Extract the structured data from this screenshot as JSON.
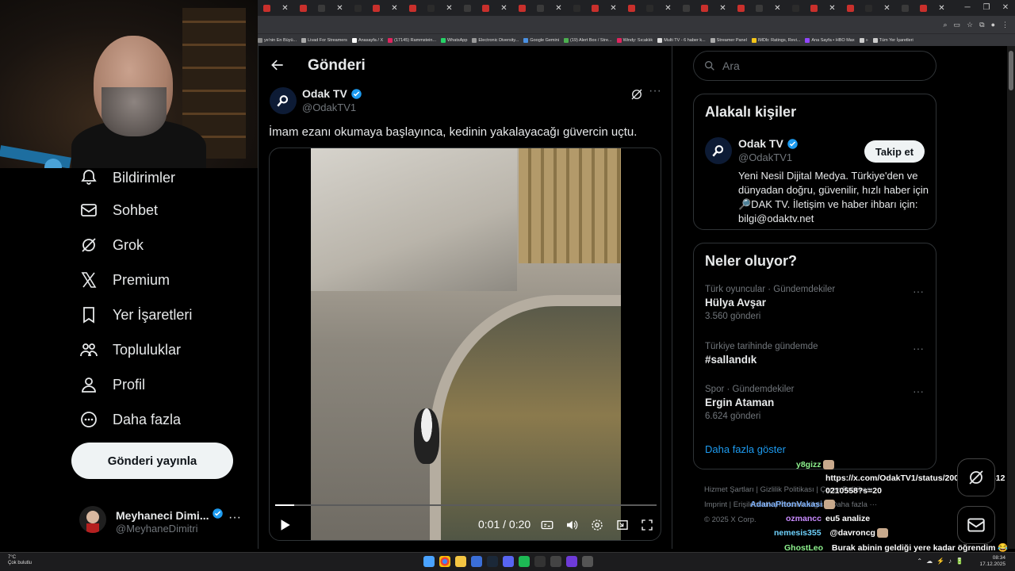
{
  "browser": {
    "tab_count": 38,
    "bookmarks": [
      "ye'nin En Büyü...",
      "Livad For Streamers",
      "Anasayfa / X",
      "(17145) Rammstein...",
      "WhatsApp",
      "Electronic Diversity...",
      "Google Gemini",
      "(19) Alert Box / Stre...",
      "Windy: Sıcaklık",
      "Multi TV - 6 haber k...",
      "Streamer Panel",
      "IMDb: Ratings, Revi...",
      "Ana Sayfa • HBO Max",
      "»",
      "Tüm Yer İşaretleri"
    ]
  },
  "nav": {
    "items": [
      {
        "label": "Bildirimler",
        "icon": "bell-icon"
      },
      {
        "label": "Sohbet",
        "icon": "mail-icon"
      },
      {
        "label": "Grok",
        "icon": "grok-icon"
      },
      {
        "label": "Premium",
        "icon": "x-logo-icon"
      },
      {
        "label": "Yer İşaretleri",
        "icon": "bookmark-icon"
      },
      {
        "label": "Topluluklar",
        "icon": "people-icon"
      },
      {
        "label": "Profil",
        "icon": "person-icon"
      },
      {
        "label": "Daha fazla",
        "icon": "more-circle-icon"
      }
    ],
    "post_button": "Gönderi yayınla",
    "account": {
      "name": "Meyhaneci Dimi...",
      "handle": "@MeyhaneDimitri",
      "more": "···"
    }
  },
  "main": {
    "header_title": "Gönderi",
    "tweet": {
      "author_name": "Odak TV",
      "author_handle": "@OdakTV1",
      "more": "···",
      "text": "İmam ezanı okumaya başlayınca, kedinin yakalayacağı güvercin uçtu.",
      "video": {
        "time": "0:01 / 0:20",
        "progress": 0.05
      }
    }
  },
  "right": {
    "search_placeholder": "Ara",
    "related": {
      "title": "Alakalı kişiler",
      "name": "Odak TV",
      "handle": "@OdakTV1",
      "follow_label": "Takip et",
      "bio": "Yeni Nesil Dijital Medya. Türkiye'den ve dünyadan doğru, güvenilir, hızlı haber için 🔎DAK TV. İletişim ve haber ihbarı için: bilgi@odaktv.net"
    },
    "trends": {
      "title": "Neler oluyor?",
      "items": [
        {
          "context": "Türk oyuncular · Gündemdekiler",
          "topic": "Hülya Avşar",
          "count": "3.560 gönderi"
        },
        {
          "context": "Türkiye tarihinde gündemde",
          "topic": "#sallandık",
          "count": ""
        },
        {
          "context": "Spor · Gündemdekiler",
          "topic": "Ergin Ataman",
          "count": "6.624 gönderi"
        }
      ],
      "show_more": "Daha fazla göster"
    },
    "footer": {
      "line1": "Hizmet Şartları  |  Gizlilik Politikası  |  Çerez Politikası",
      "line2": "Imprint  |  Erişilebilirlik  |  Reklam bilgisi  |  Daha fazla ···",
      "line3": "© 2025 X Corp."
    }
  },
  "chat": [
    {
      "user": "y8gizz",
      "message": "",
      "color": "#8ef28e"
    },
    {
      "user": "",
      "message": "https://x.com/OdakTV1/status/2000822292612",
      "color": "#ffffff"
    },
    {
      "user": "",
      "message": "0210558?s=20",
      "color": "#ffffff"
    },
    {
      "user": "AdanaPitonVakasi",
      "message": "",
      "color": "#7fb3ff"
    },
    {
      "user": "",
      "message": "eu5 analize",
      "color": "#ffffff"
    },
    {
      "user": "ozmancc",
      "message": "",
      "color": "#c98bff"
    },
    {
      "user": "nemesis355",
      "message": "@davroncg",
      "color": "#6fd3ff"
    },
    {
      "user": "GhostLeo",
      "message": "Burak abinin geldiği yere kadar öğrendim 😂",
      "color": "#8ef28e"
    },
    {
      "user": "",
      "message": "😂😂",
      "color": "#ffffff"
    }
  ],
  "taskbar": {
    "weather_temp": "7°C",
    "weather_desc": "Çok bulutlu",
    "time": "08:34",
    "date": "17.12.2025"
  },
  "colors": {
    "accent": "#1d9bf0",
    "bg": "#000000",
    "verified": "#1d9bf0"
  }
}
